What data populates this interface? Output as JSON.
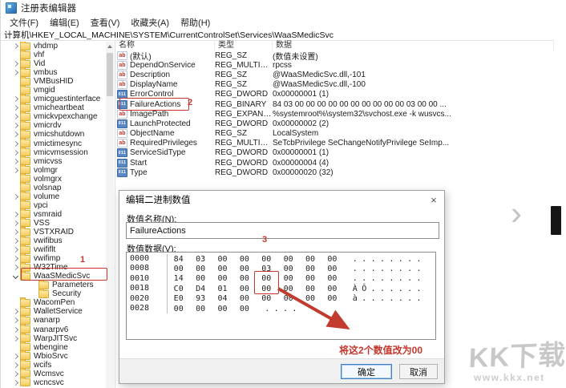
{
  "window": {
    "title": "注册表编辑器",
    "menu": [
      "文件(F)",
      "编辑(E)",
      "查看(V)",
      "收藏夹(A)",
      "帮助(H)"
    ],
    "address": "计算机\\HKEY_LOCAL_MACHINE\\SYSTEM\\CurrentControlSet\\Services\\WaaSMedicSvc"
  },
  "tree": {
    "items": [
      {
        "label": "vhdmp",
        "state": "collapsed",
        "depth": 1
      },
      {
        "label": "vhf",
        "state": "none",
        "depth": 1
      },
      {
        "label": "Vid",
        "state": "collapsed",
        "depth": 1
      },
      {
        "label": "vmbus",
        "state": "collapsed",
        "depth": 1
      },
      {
        "label": "VMBusHID",
        "state": "none",
        "depth": 1
      },
      {
        "label": "vmgid",
        "state": "none",
        "depth": 1
      },
      {
        "label": "vmicguestinterface",
        "state": "collapsed",
        "depth": 1
      },
      {
        "label": "vmicheartbeat",
        "state": "collapsed",
        "depth": 1
      },
      {
        "label": "vmickvpexchange",
        "state": "collapsed",
        "depth": 1
      },
      {
        "label": "vmicrdv",
        "state": "collapsed",
        "depth": 1
      },
      {
        "label": "vmicshutdown",
        "state": "collapsed",
        "depth": 1
      },
      {
        "label": "vmictimesync",
        "state": "collapsed",
        "depth": 1
      },
      {
        "label": "vmicvmsession",
        "state": "collapsed",
        "depth": 1
      },
      {
        "label": "vmicvss",
        "state": "collapsed",
        "depth": 1
      },
      {
        "label": "volmgr",
        "state": "collapsed",
        "depth": 1
      },
      {
        "label": "volmgrx",
        "state": "none",
        "depth": 1
      },
      {
        "label": "volsnap",
        "state": "none",
        "depth": 1
      },
      {
        "label": "volume",
        "state": "collapsed",
        "depth": 1
      },
      {
        "label": "vpci",
        "state": "none",
        "depth": 1
      },
      {
        "label": "vsmraid",
        "state": "collapsed",
        "depth": 1
      },
      {
        "label": "VSS",
        "state": "collapsed",
        "depth": 1
      },
      {
        "label": "VSTXRAID",
        "state": "collapsed",
        "depth": 1
      },
      {
        "label": "vwifibus",
        "state": "collapsed",
        "depth": 1
      },
      {
        "label": "vwififlt",
        "state": "collapsed",
        "depth": 1
      },
      {
        "label": "vwifimp",
        "state": "collapsed",
        "depth": 1
      },
      {
        "label": "W32Time",
        "state": "collapsed",
        "depth": 1
      },
      {
        "label": "WaaSMedicSvc",
        "state": "expanded",
        "depth": 1
      },
      {
        "label": "Parameters",
        "state": "none",
        "depth": 2
      },
      {
        "label": "Security",
        "state": "none",
        "depth": 2
      },
      {
        "label": "WacomPen",
        "state": "none",
        "depth": 1
      },
      {
        "label": "WalletService",
        "state": "collapsed",
        "depth": 1
      },
      {
        "label": "wanarp",
        "state": "collapsed",
        "depth": 1
      },
      {
        "label": "wanarpv6",
        "state": "collapsed",
        "depth": 1
      },
      {
        "label": "WarpJITSvc",
        "state": "collapsed",
        "depth": 1
      },
      {
        "label": "wbengine",
        "state": "none",
        "depth": 1
      },
      {
        "label": "WbioSrvc",
        "state": "collapsed",
        "depth": 1
      },
      {
        "label": "wcifs",
        "state": "collapsed",
        "depth": 1
      },
      {
        "label": "Wcmsvc",
        "state": "collapsed",
        "depth": 1
      },
      {
        "label": "wcncsvc",
        "state": "collapsed",
        "depth": 1
      }
    ]
  },
  "values": {
    "columns": [
      "名称",
      "类型",
      "数据"
    ],
    "rows": [
      {
        "name": "(默认)",
        "type": "REG_SZ",
        "data": "(数值未设置)",
        "icon": "sz"
      },
      {
        "name": "DependOnService",
        "type": "REG_MULTI_SZ",
        "data": "rpcss",
        "icon": "sz"
      },
      {
        "name": "Description",
        "type": "REG_SZ",
        "data": "@WaaSMedicSvc.dll,-101",
        "icon": "sz"
      },
      {
        "name": "DisplayName",
        "type": "REG_SZ",
        "data": "@WaaSMedicSvc.dll,-100",
        "icon": "sz"
      },
      {
        "name": "ErrorControl",
        "type": "REG_DWORD",
        "data": "0x00000001 (1)",
        "icon": "bin"
      },
      {
        "name": "FailureActions",
        "type": "REG_BINARY",
        "data": "84 03 00 00 00 00 00 00 00 00 00 00 03 00 00 ...",
        "icon": "bin"
      },
      {
        "name": "ImagePath",
        "type": "REG_EXPAND_SZ",
        "data": "%systemroot%\\system32\\svchost.exe -k wusvcs...",
        "icon": "sz"
      },
      {
        "name": "LaunchProtected",
        "type": "REG_DWORD",
        "data": "0x00000002 (2)",
        "icon": "bin"
      },
      {
        "name": "ObjectName",
        "type": "REG_SZ",
        "data": "LocalSystem",
        "icon": "sz"
      },
      {
        "name": "RequiredPrivileges",
        "type": "REG_MULTI_SZ",
        "data": "SeTcbPrivilege SeChangeNotifyPrivilege SeImp...",
        "icon": "sz"
      },
      {
        "name": "ServiceSidType",
        "type": "REG_DWORD",
        "data": "0x00000001 (1)",
        "icon": "bin"
      },
      {
        "name": "Start",
        "type": "REG_DWORD",
        "data": "0x00000004 (4)",
        "icon": "bin"
      },
      {
        "name": "Type",
        "type": "REG_DWORD",
        "data": "0x00000020 (32)",
        "icon": "bin"
      }
    ]
  },
  "dialog": {
    "title": "编辑二进制数值",
    "name_label": "数值名称(N):",
    "name_value": "FailureActions",
    "data_label": "数值数据(V):",
    "hex_rows": [
      {
        "offset": "0000",
        "bytes": [
          "84",
          "03",
          "00",
          "00",
          "00",
          "00",
          "00",
          "00"
        ],
        "ascii": [
          ".",
          ".",
          ".",
          ".",
          ".",
          ".",
          ".",
          "."
        ]
      },
      {
        "offset": "0008",
        "bytes": [
          "00",
          "00",
          "00",
          "00",
          "03",
          "00",
          "00",
          "00"
        ],
        "ascii": [
          ".",
          ".",
          ".",
          ".",
          ".",
          ".",
          ".",
          "."
        ]
      },
      {
        "offset": "0010",
        "bytes": [
          "14",
          "00",
          "00",
          "00",
          "00",
          "00",
          "00",
          "00"
        ],
        "ascii": [
          ".",
          ".",
          ".",
          ".",
          ".",
          ".",
          ".",
          "."
        ]
      },
      {
        "offset": "0018",
        "bytes": [
          "C0",
          "D4",
          "01",
          "00",
          "00",
          "00",
          "00",
          "00"
        ],
        "ascii": [
          "À",
          "Ô",
          ".",
          ".",
          ".",
          ".",
          ".",
          "."
        ]
      },
      {
        "offset": "0020",
        "bytes": [
          "E0",
          "93",
          "04",
          "00",
          "00",
          "00",
          "00",
          "00"
        ],
        "ascii": [
          "à",
          ".",
          ".",
          ".",
          ".",
          ".",
          ".",
          "."
        ]
      },
      {
        "offset": "0028",
        "bytes": [
          "00",
          "00",
          "00",
          "00"
        ],
        "ascii": [
          ".",
          ".",
          ".",
          "."
        ]
      }
    ],
    "ok": "确定",
    "cancel": "取消"
  },
  "annotations": {
    "step1": "1",
    "step2": "2",
    "step3": "3",
    "note": "将这2个数值改为00",
    "color": "#c5372c",
    "highlight_cells": [
      {
        "row": 2,
        "col": 4
      },
      {
        "row": 3,
        "col": 4
      }
    ]
  },
  "watermark": {
    "logo": "KK下载",
    "url": "www.kkx.net"
  },
  "page": {
    "next_chevron": "›"
  }
}
